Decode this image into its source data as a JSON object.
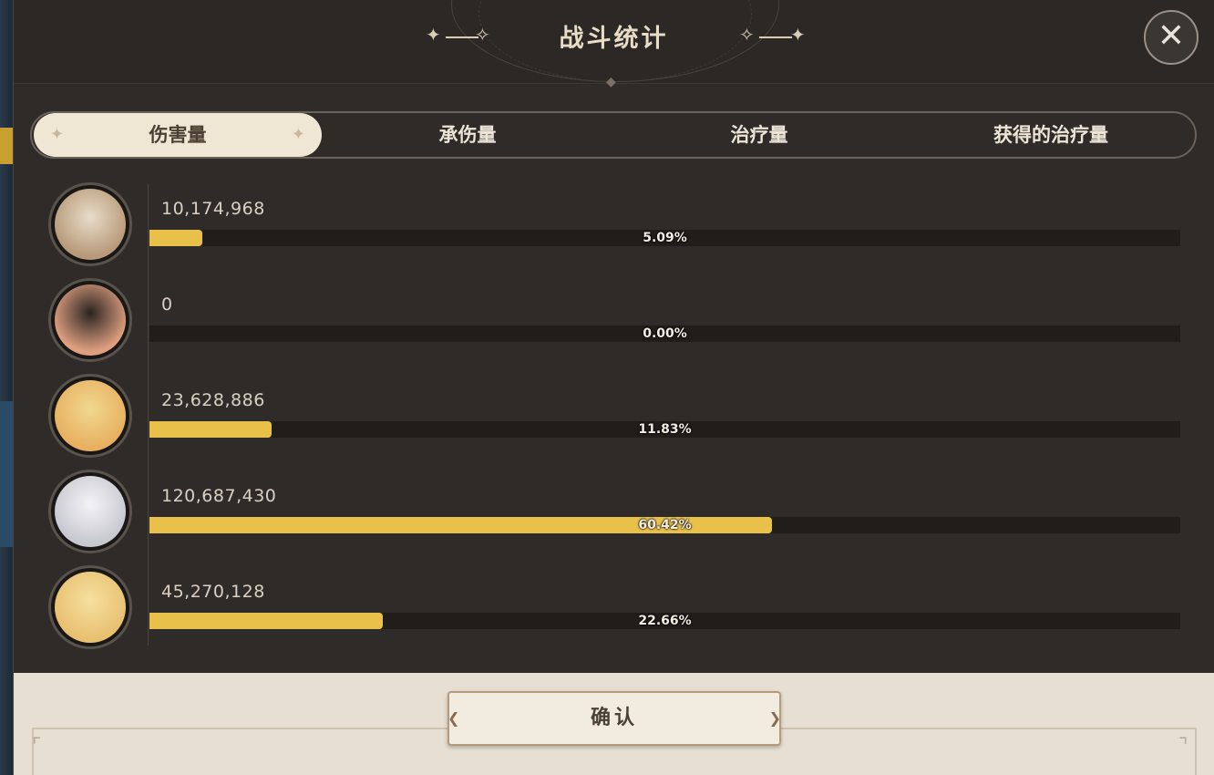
{
  "dialog": {
    "title": "战斗统计",
    "close_icon": "close-icon"
  },
  "tabs": [
    {
      "label": "伤害量",
      "active": true
    },
    {
      "label": "承伤量",
      "active": false
    },
    {
      "label": "治疗量",
      "active": false
    },
    {
      "label": "获得的治疗量",
      "active": false
    }
  ],
  "stats": [
    {
      "value": "10,174,968",
      "percent": "5.09%",
      "fraction": 0.0509,
      "avatar_colors": [
        "#e8dcc8",
        "#b89a7a"
      ]
    },
    {
      "value": "0",
      "percent": "0.00%",
      "fraction": 0.0,
      "avatar_colors": [
        "#2a2422",
        "#e0a080"
      ]
    },
    {
      "value": "23,628,886",
      "percent": "11.83%",
      "fraction": 0.1183,
      "avatar_colors": [
        "#f0d890",
        "#e8b060"
      ]
    },
    {
      "value": "120,687,430",
      "percent": "60.42%",
      "fraction": 0.6042,
      "avatar_colors": [
        "#f4f4f6",
        "#c8c8d0"
      ]
    },
    {
      "value": "45,270,128",
      "percent": "22.66%",
      "fraction": 0.2266,
      "avatar_colors": [
        "#f6e0a0",
        "#e8c070"
      ]
    }
  ],
  "footer": {
    "confirm_label": "确认"
  },
  "colors": {
    "bar_fill": "#e8c04a",
    "bar_track": "#201d1b",
    "panel": "#2f2b28",
    "footer": "#e7dfd2"
  }
}
